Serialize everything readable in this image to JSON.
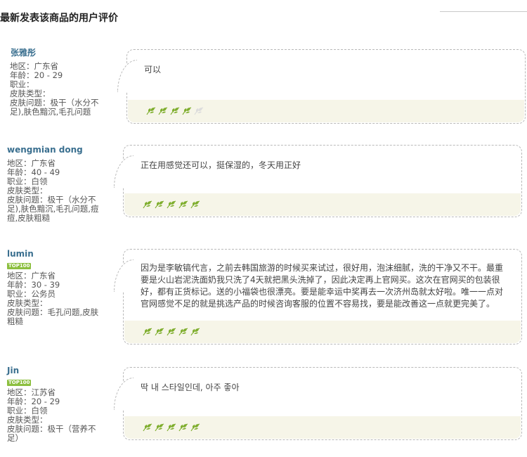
{
  "page": {
    "title": "最新发表该商品的用户评价"
  },
  "labels": {
    "region": "地区：",
    "age": "年龄：",
    "job": "职业：",
    "skin_type": "皮肤类型：",
    "skin_issue": "皮肤问题："
  },
  "reviews": [
    {
      "user": "张雅彤",
      "badge": "",
      "region": "广东省",
      "age": "20 - 29",
      "job": "",
      "skin_type": "",
      "skin_issue": "极干（水分不足),肤色黯沉,毛孔问题",
      "text": "可以",
      "rating": 4,
      "rating_max": 5
    },
    {
      "user": "wengmian dong",
      "badge": "",
      "region": "广东省",
      "age": "40 - 49",
      "job": "白领",
      "skin_type": "",
      "skin_issue": "极干（水分不足),肤色黯沉,毛孔问题,痘痘,皮肤粗糙",
      "text": "正在用感觉还可以，挺保湿的，冬天用正好",
      "rating": 5,
      "rating_max": 5
    },
    {
      "user": "lumin",
      "badge": "TOP100",
      "region": "广东省",
      "age": "30 - 39",
      "job": "公务员",
      "skin_type": "",
      "skin_issue": "毛孔问题,皮肤粗糙",
      "text": "因为是李敏镐代言，之前去韩国旅游的时候买来试过，很好用，泡沫细腻，洗的干净又不干。最重要是火山岩泥洗面奶我只洗了4天就把黑头洗掉了，因此决定再上官网买。这次在官网买的包装很好，都有正货标记。送的小福袋也很漂亮。要是能幸运中奖再去一次济州岛就太好啦。唯一一点对官网感觉不足的就是挑选产品的时候咨询客服的位置不容易找，要是能改善这一点就更完美了。",
      "rating": 5,
      "rating_max": 5
    },
    {
      "user": "Jin",
      "badge": "TOP100",
      "region": "江苏省",
      "age": "20 - 29",
      "job": "白领",
      "skin_type": "",
      "skin_issue": "极干（营养不足）",
      "text": "딱 내 스타일인데, 아주 좋아",
      "rating": 5,
      "rating_max": 5
    }
  ],
  "colors": {
    "leaf_active": "#7fae2e",
    "leaf_inactive": "#dcdcdc",
    "name": "#3a6f8f",
    "badge": "#8cbf3f",
    "rating_bg": "#f6f5e8"
  }
}
